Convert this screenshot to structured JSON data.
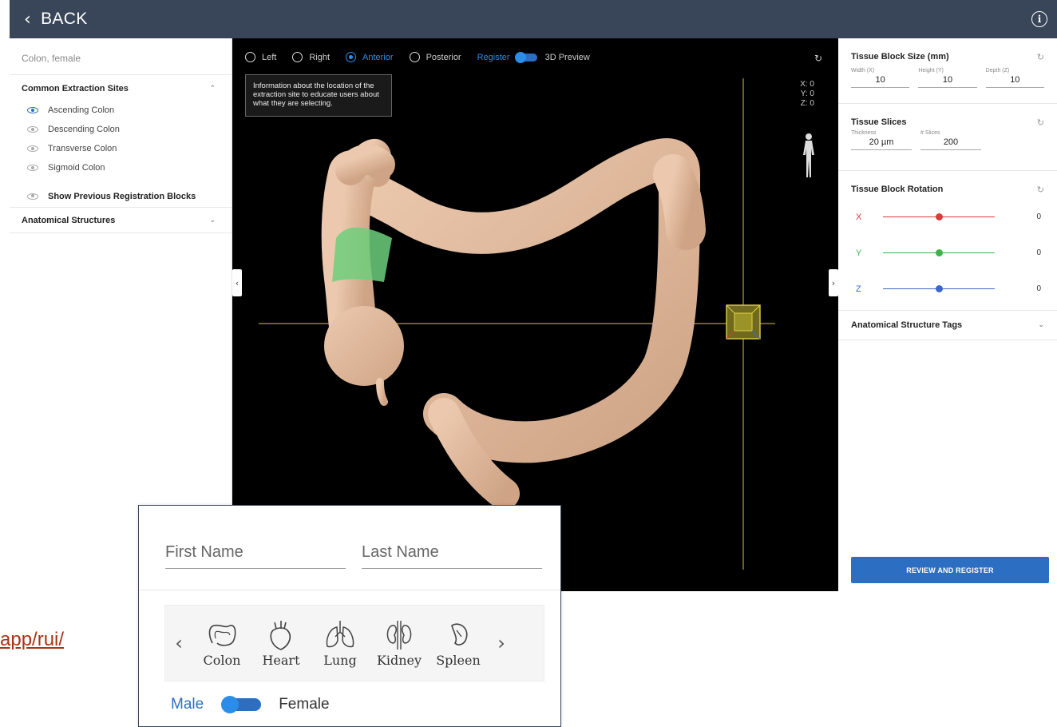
{
  "topbar": {
    "back_label": "BACK",
    "info_icon": "info-icon"
  },
  "left": {
    "organ_title": "Colon, female",
    "extraction_header": "Common Extraction Sites",
    "sites": [
      {
        "label": "Ascending Colon",
        "visible": true
      },
      {
        "label": "Descending Colon",
        "visible": false
      },
      {
        "label": "Transverse Colon",
        "visible": false
      },
      {
        "label": "Sigmoid Colon",
        "visible": false
      }
    ],
    "previous_blocks": "Show Previous Registration Blocks",
    "anatomical_header": "Anatomical Structures"
  },
  "viewer": {
    "views": [
      "Left",
      "Right",
      "Anterior",
      "Posterior"
    ],
    "selected_view": "Anterior",
    "register_label": "Register",
    "preview_label": "3D Preview",
    "tooltip": "Information about the location of the extraction site to educate users about what they are selecting.",
    "coords": {
      "x": "X: 0",
      "y": "Y: 0",
      "z": "Z: 0"
    }
  },
  "right": {
    "block_size": {
      "title": "Tissue Block Size (mm)",
      "fields": [
        {
          "label": "Width (X)",
          "value": "10"
        },
        {
          "label": "Height (Y)",
          "value": "10"
        },
        {
          "label": "Depth (Z)",
          "value": "10"
        }
      ]
    },
    "slices": {
      "title": "Tissue Slices",
      "fields": [
        {
          "label": "Thickness",
          "value": "20 µm"
        },
        {
          "label": "# Slices",
          "value": "200"
        }
      ]
    },
    "rotation": {
      "title": "Tissue Block Rotation",
      "axes": [
        {
          "axis": "X",
          "value": "0",
          "color": "#d93a3a",
          "position": 0.5
        },
        {
          "axis": "Y",
          "value": "0",
          "color": "#3fb04a",
          "position": 0.5
        },
        {
          "axis": "Z",
          "value": "0",
          "color": "#3a66c8",
          "position": 0.5
        }
      ]
    },
    "structure_tags": "Anatomical Structure Tags",
    "review_button": "REVIEW AND REGISTER"
  },
  "link_text": "app/rui/",
  "inset": {
    "first_name_placeholder": "First Name",
    "last_name_placeholder": "Last Name",
    "organs": [
      "Colon",
      "Heart",
      "Lung",
      "Kidney",
      "Spleen"
    ],
    "sex_male": "Male",
    "sex_female": "Female"
  },
  "colors": {
    "topbar": "#39465a",
    "accent": "#2c6fc2",
    "highlight": "#6dcf7c",
    "tissue": "#e2b99e"
  }
}
